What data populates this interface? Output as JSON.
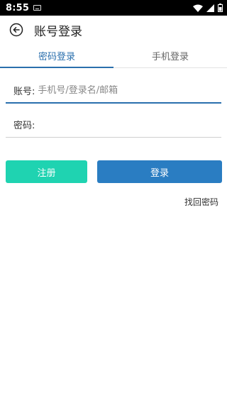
{
  "status_bar": {
    "time": "8:55",
    "icons": [
      "keyboard-icon",
      "wifi-icon",
      "cellular-icon",
      "battery-icon"
    ]
  },
  "header": {
    "back_icon": "back-arrow-icon",
    "title": "账号登录"
  },
  "tabs": [
    {
      "label": "密码登录",
      "active": true
    },
    {
      "label": "手机登录",
      "active": false
    }
  ],
  "form": {
    "account": {
      "label": "账号:",
      "value": "",
      "placeholder": "手机号/登录名/邮箱"
    },
    "password": {
      "label": "密码:",
      "value": "",
      "placeholder": ""
    }
  },
  "buttons": {
    "register": "注册",
    "login": "登录",
    "forgot_password": "找回密码"
  },
  "colors": {
    "accent": "#2a6fad",
    "register_button": "#1fd3b1",
    "login_button": "#2a7dc2"
  }
}
